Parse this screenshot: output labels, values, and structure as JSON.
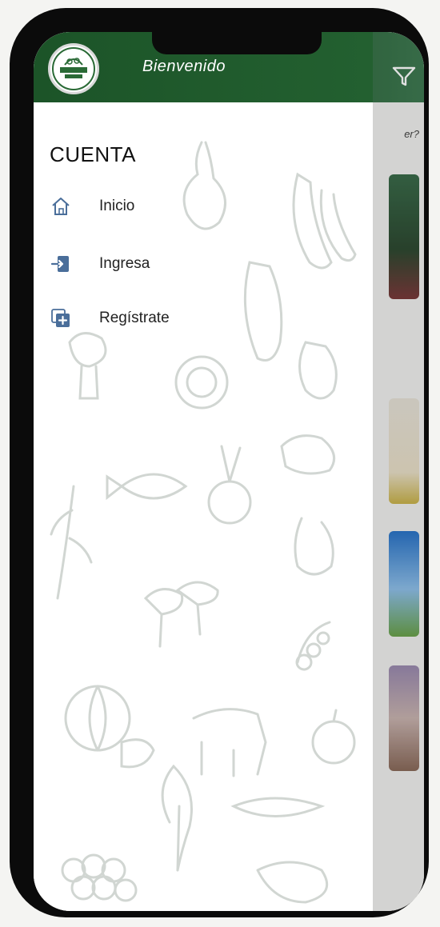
{
  "header": {
    "welcome_text": "Bienvenido",
    "logo_text": "BIENVENIDA",
    "header_color": "#1f5a2c"
  },
  "drawer": {
    "section_title": "CUENTA",
    "items": [
      {
        "label": "Inicio",
        "icon": "home-icon"
      },
      {
        "label": "Ingresa",
        "icon": "login-icon"
      },
      {
        "label": "Regístrate",
        "icon": "register-icon"
      }
    ]
  },
  "background": {
    "question_fragment": "er?"
  },
  "colors": {
    "accent_icon": "#4a6e9a"
  }
}
